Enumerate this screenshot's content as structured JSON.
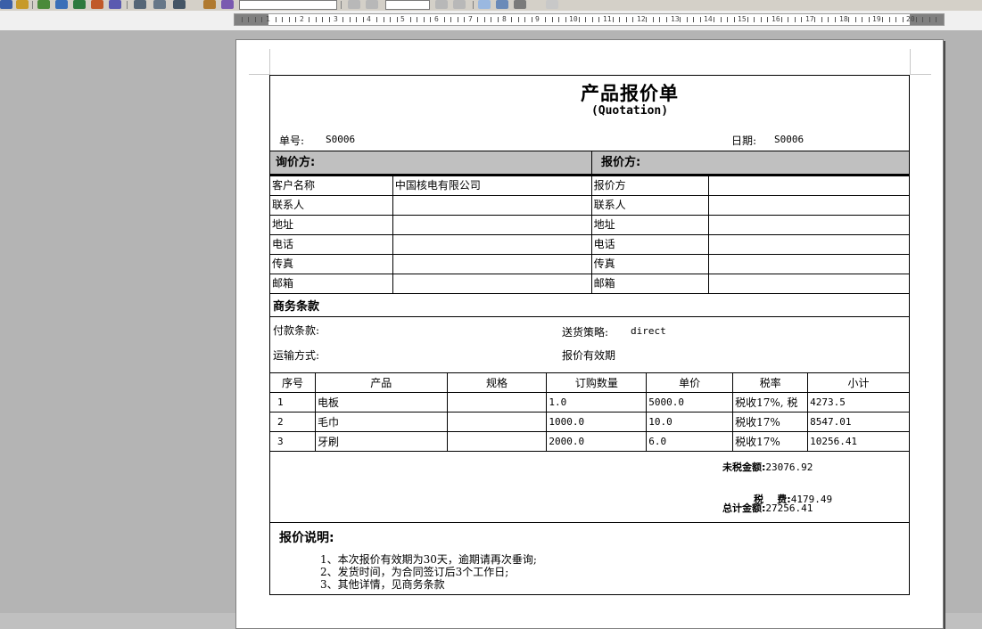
{
  "toolbar": {
    "zoom_value": "",
    "page_value": ""
  },
  "ruler": {
    "numbers": [
      "1",
      "2",
      "3",
      "4",
      "5",
      "6",
      "7",
      "8",
      "9",
      "10",
      "11",
      "12",
      "13",
      "14",
      "15",
      "16",
      "17",
      "18",
      "19",
      "20"
    ]
  },
  "doc": {
    "title": "产品报价单",
    "subtitle": "(Quotation)",
    "number_label": "单号:",
    "number_value": "S0006",
    "date_label": "日期:",
    "date_value": "S0006",
    "inquirer_header": "询价方:",
    "quoter_header": "报价方:",
    "info_rows": [
      {
        "left_label": "客户名称",
        "left_value": "中国核电有限公司",
        "right_label": "报价方",
        "right_value": ""
      },
      {
        "left_label": "联系人",
        "left_value": "",
        "right_label": "联系人",
        "right_value": ""
      },
      {
        "left_label": "地址",
        "left_value": "",
        "right_label": "地址",
        "right_value": ""
      },
      {
        "left_label": "电话",
        "left_value": "",
        "right_label": "电话",
        "right_value": ""
      },
      {
        "left_label": "传真",
        "left_value": "",
        "right_label": "传真",
        "right_value": ""
      },
      {
        "left_label": "邮箱",
        "left_value": "",
        "right_label": "邮箱",
        "right_value": ""
      }
    ],
    "terms_header": "商务条款",
    "payment_label": "付款条款:",
    "delivery_label": "送货策略:",
    "delivery_value": "direct",
    "shipping_label": "运输方式:",
    "validity_label": "报价有效期",
    "items_columns": [
      "序号",
      "产品",
      "规格",
      "订购数量",
      "单价",
      "税率",
      "小计"
    ],
    "items": [
      {
        "no": "1",
        "product": "电板",
        "spec": "",
        "qty": "1.0",
        "price": "5000.0",
        "tax": "税收17%, 税",
        "subtotal": "4273.5"
      },
      {
        "no": "2",
        "product": "毛巾",
        "spec": "",
        "qty": "1000.0",
        "price": "10.0",
        "tax": "税收17%",
        "subtotal": "8547.01"
      },
      {
        "no": "3",
        "product": "牙刷",
        "spec": "",
        "qty": "2000.0",
        "price": "6.0",
        "tax": "税收17%",
        "subtotal": "10256.41"
      }
    ],
    "totals": {
      "untaxed_label": "未税金额:",
      "untaxed_value": "23076.92",
      "tax_label": "税    费:",
      "tax_value": "4179.49",
      "total_label": "总计金额:",
      "total_value": "27256.41"
    },
    "notes_header": "报价说明:",
    "notes": [
      "1、本次报价有效期为30天，逾期请再次垂询;",
      "2、发货时间，为合同签订后3个工作日;",
      "3、其他详情，见商务条款"
    ]
  }
}
